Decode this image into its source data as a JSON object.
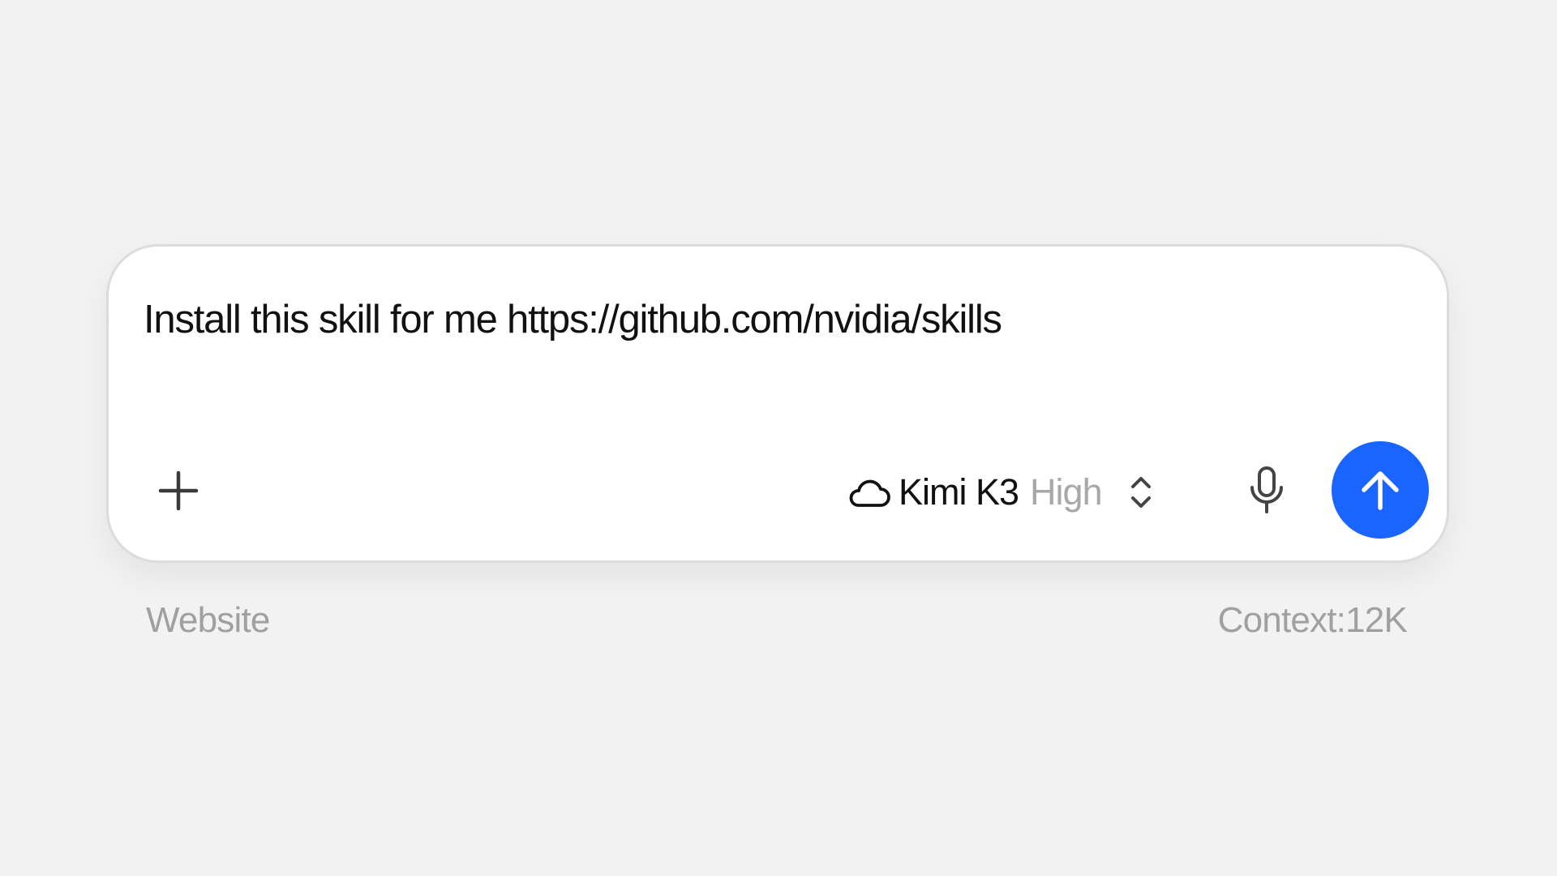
{
  "composer": {
    "prompt_text": "Install this skill for me https://github.com/nvidia/skills",
    "add_icon": "plus-icon",
    "model": {
      "icon": "cloud-icon",
      "name": "Kimi K3",
      "effort": "High",
      "toggle_icon": "chevron-up-down-icon"
    },
    "mic_icon": "microphone-icon",
    "send_icon": "arrow-up-icon",
    "send_color": "#1a64ff"
  },
  "footer": {
    "left_label": "Website",
    "context_label": "Context:12K"
  }
}
